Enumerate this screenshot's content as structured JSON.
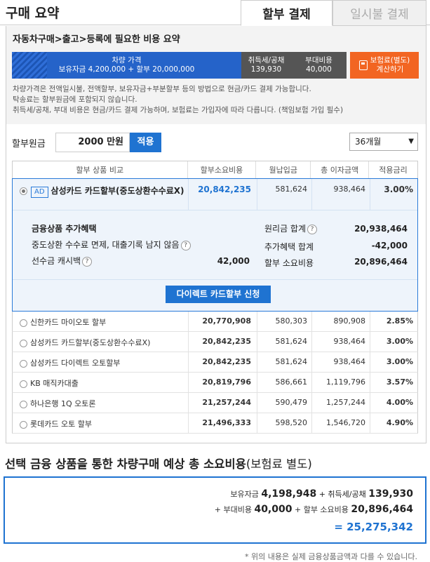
{
  "header": {
    "title": "구매 요약",
    "tabs": [
      {
        "label": "할부 결제",
        "active": true
      },
      {
        "label": "일시불 결제",
        "active": false
      }
    ]
  },
  "summary": {
    "title": "자동차구매>출고>등록에 필요한 비용 요약",
    "car_price": {
      "label": "차량 가격",
      "detail": "보유자금 4,200,000 + 할부 20,000,000"
    },
    "tax": {
      "label": "취득세/공채",
      "value": "139,930"
    },
    "extra": {
      "label": "부대비용",
      "value": "40,000"
    },
    "insurance": {
      "label1": "보험료(별도)",
      "label2": "계산하기",
      "icon": "calculator-icon"
    },
    "notes": [
      "차량가격은 전액일시불, 전액할부, 보유자금+부분할부 등의 방법으로 현금/카드 결제 가능합니다.",
      "탁송료는 할부원금에 포함되지 않습니다.",
      "취득세/공채, 부대 비용은 현금/카드 결제 가능하며, 보험료는 가입자에 따라 다릅니다. (책임보험 가입 필수)"
    ]
  },
  "controls": {
    "principal_label": "할부원금",
    "principal_value": "2000 만원",
    "apply_label": "적용",
    "term_value": "36개월"
  },
  "table": {
    "headers": [
      "할부 상품 비교",
      "할부소요비용",
      "월납입금",
      "총 이자금액",
      "적용금리"
    ]
  },
  "selected": {
    "ad": "AD",
    "name": "삼성카드 카드할부(중도상환수수료X)",
    "cost": "20,842,235",
    "monthly": "581,624",
    "interest": "938,464",
    "rate": "3.00%",
    "benefit_title": "금융상품 추가혜택",
    "benefit_1": "중도상환 수수료 면제, 대출기록 남지 않음",
    "benefit_2": "선수금 캐시백",
    "benefit_2_value": "42,000",
    "sum_label_1": "원리금 합계",
    "sum_value_1": "20,938,464",
    "sum_label_2": "추가혜택 합계",
    "sum_value_2": "-42,000",
    "sum_label_3": "할부 소요비용",
    "sum_value_3": "20,896,464",
    "button": "다이렉트 카드할부 신청"
  },
  "products": [
    {
      "name": "신한카드 마이오토 할부",
      "cost": "20,770,908",
      "monthly": "580,303",
      "interest": "890,908",
      "rate": "2.85%"
    },
    {
      "name": "삼성카드 카드할부(중도상환수수료X)",
      "cost": "20,842,235",
      "monthly": "581,624",
      "interest": "938,464",
      "rate": "3.00%"
    },
    {
      "name": "삼성카드 다이렉트 오토할부",
      "cost": "20,842,235",
      "monthly": "581,624",
      "interest": "938,464",
      "rate": "3.00%"
    },
    {
      "name": "KB 매직카대출",
      "cost": "20,819,796",
      "monthly": "586,661",
      "interest": "1,119,796",
      "rate": "3.57%"
    },
    {
      "name": "하나은행 1Q 오토론",
      "cost": "21,257,244",
      "monthly": "590,479",
      "interest": "1,257,244",
      "rate": "4.00%"
    },
    {
      "name": "롯데카드 오토 할부",
      "cost": "21,496,333",
      "monthly": "598,520",
      "interest": "1,546,720",
      "rate": "4.90%"
    }
  ],
  "total": {
    "title": "선택 금융 상품을 통한 차량구매 예상 총 소요비용",
    "title_sub": "(보험료 별도)",
    "l1_a": "보유자금",
    "l1_av": "4,198,948",
    "l1_b": "+ 취득세/공채",
    "l1_bv": "139,930",
    "l2_a": "+ 부대비용",
    "l2_av": "40,000",
    "l2_b": "+ 할부 소요비용",
    "l2_bv": "20,896,464",
    "grand": "= 25,275,342",
    "footnote": "* 위의 내용은 실제 금융상품금액과 다를 수 있습니다."
  },
  "colors": {
    "accent": "#1f73d1",
    "orange": "#f26522",
    "dark": "#555555"
  }
}
